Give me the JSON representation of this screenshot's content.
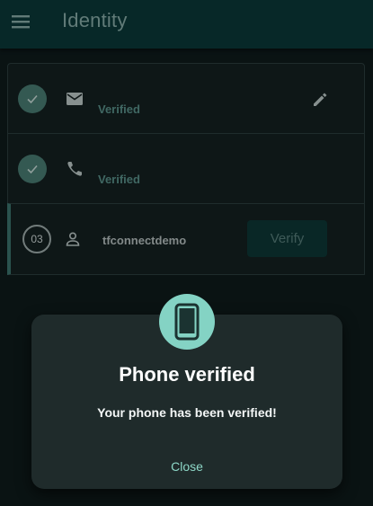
{
  "appbar": {
    "title": "Identity",
    "menu_icon": "menu-icon"
  },
  "identity_steps": [
    {
      "status": "Verified",
      "icon": "email-icon",
      "done": true,
      "editable": true
    },
    {
      "status": "Verified",
      "icon": "phone-icon",
      "done": true,
      "editable": false
    },
    {
      "step_number": "03",
      "icon": "person-icon",
      "username": "tfconnectdemo",
      "button_label": "Verify",
      "done": false
    }
  ],
  "dialog": {
    "icon": "smartphone-icon",
    "title": "Phone verified",
    "message": "Your phone has been verified!",
    "close_label": "Close"
  },
  "colors": {
    "background": "#0f1c1d",
    "appbar": "#0b3b3b",
    "accent": "#84d3c4",
    "check": "#4d8379",
    "dialog": "#1f2b2b"
  }
}
